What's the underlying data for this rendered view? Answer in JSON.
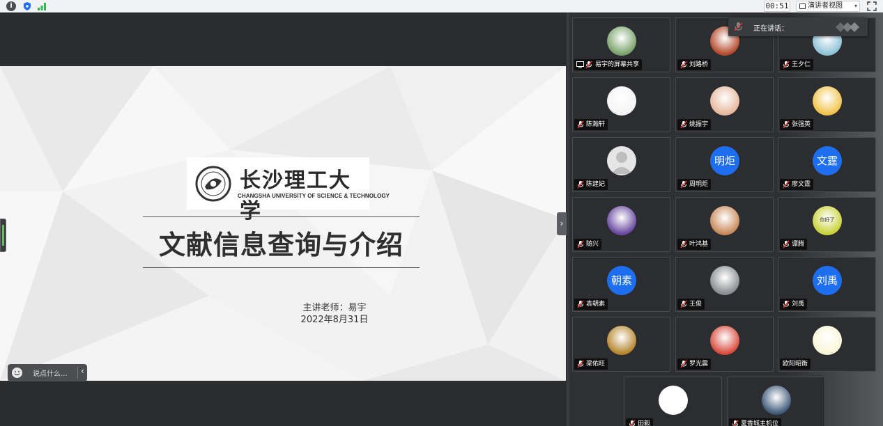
{
  "topbar": {
    "info_label": "i",
    "icons": [
      "info-icon",
      "shield-icon",
      "signal-icon",
      "presenter-view-icon",
      "chevron-down-icon",
      "fullscreen-icon"
    ],
    "timer": "00:51",
    "presenter_view_label": "演讲者视图"
  },
  "slide": {
    "logo_cn": "长沙理工大学",
    "logo_en": "CHANGSHA UNIVERSITY OF SCIENCE & TECHNOLOGY",
    "title": "文献信息查询与介绍",
    "lecturer": "主讲老师：易宇",
    "date": "2022年8月31日"
  },
  "chat": {
    "placeholder": "说点什么...",
    "collapse_glyph": "‹"
  },
  "splitter": {
    "glyph": "›"
  },
  "speaking": {
    "label": "正在讲话："
  },
  "colors": {
    "accent_blue": "#1e6ff0",
    "mic_red": "#e03a3a",
    "stage_bg": "#2b2c2e",
    "slide_bg": "#f3f3f3"
  },
  "participants": [
    {
      "name": "易宇的屏幕共享",
      "avatar": "photo",
      "screen_share": true
    },
    {
      "name": "刘路桥",
      "avatar": "photo"
    },
    {
      "name": "王夕仁",
      "avatar": "photo"
    },
    {
      "name": "陈瀚轩",
      "avatar": "photo"
    },
    {
      "name": "姚振宇",
      "avatar": "photo"
    },
    {
      "name": "张强英",
      "avatar": "photo"
    },
    {
      "name": "陈建妃",
      "avatar": "default"
    },
    {
      "name": "周明炬",
      "avatar": "text",
      "avatar_text": "明炬"
    },
    {
      "name": "廖文霆",
      "avatar": "text",
      "avatar_text": "文霆"
    },
    {
      "name": "随兴",
      "avatar": "photo"
    },
    {
      "name": "叶鸿基",
      "avatar": "photo"
    },
    {
      "name": "谭腾",
      "avatar": "photo",
      "avatar_text": "你好了"
    },
    {
      "name": "袁朝素",
      "avatar": "text",
      "avatar_text": "朝素"
    },
    {
      "name": "王俊",
      "avatar": "photo"
    },
    {
      "name": "刘禹",
      "avatar": "text",
      "avatar_text": "刘禹"
    },
    {
      "name": "梁佑旺",
      "avatar": "photo"
    },
    {
      "name": "罗光震",
      "avatar": "photo"
    },
    {
      "name": "欧阳昭衡",
      "avatar": "photo",
      "no_mic": true
    },
    {
      "name": "田毅",
      "avatar": "photo"
    },
    {
      "name": "夏香城主机位",
      "avatar": "photo"
    }
  ]
}
